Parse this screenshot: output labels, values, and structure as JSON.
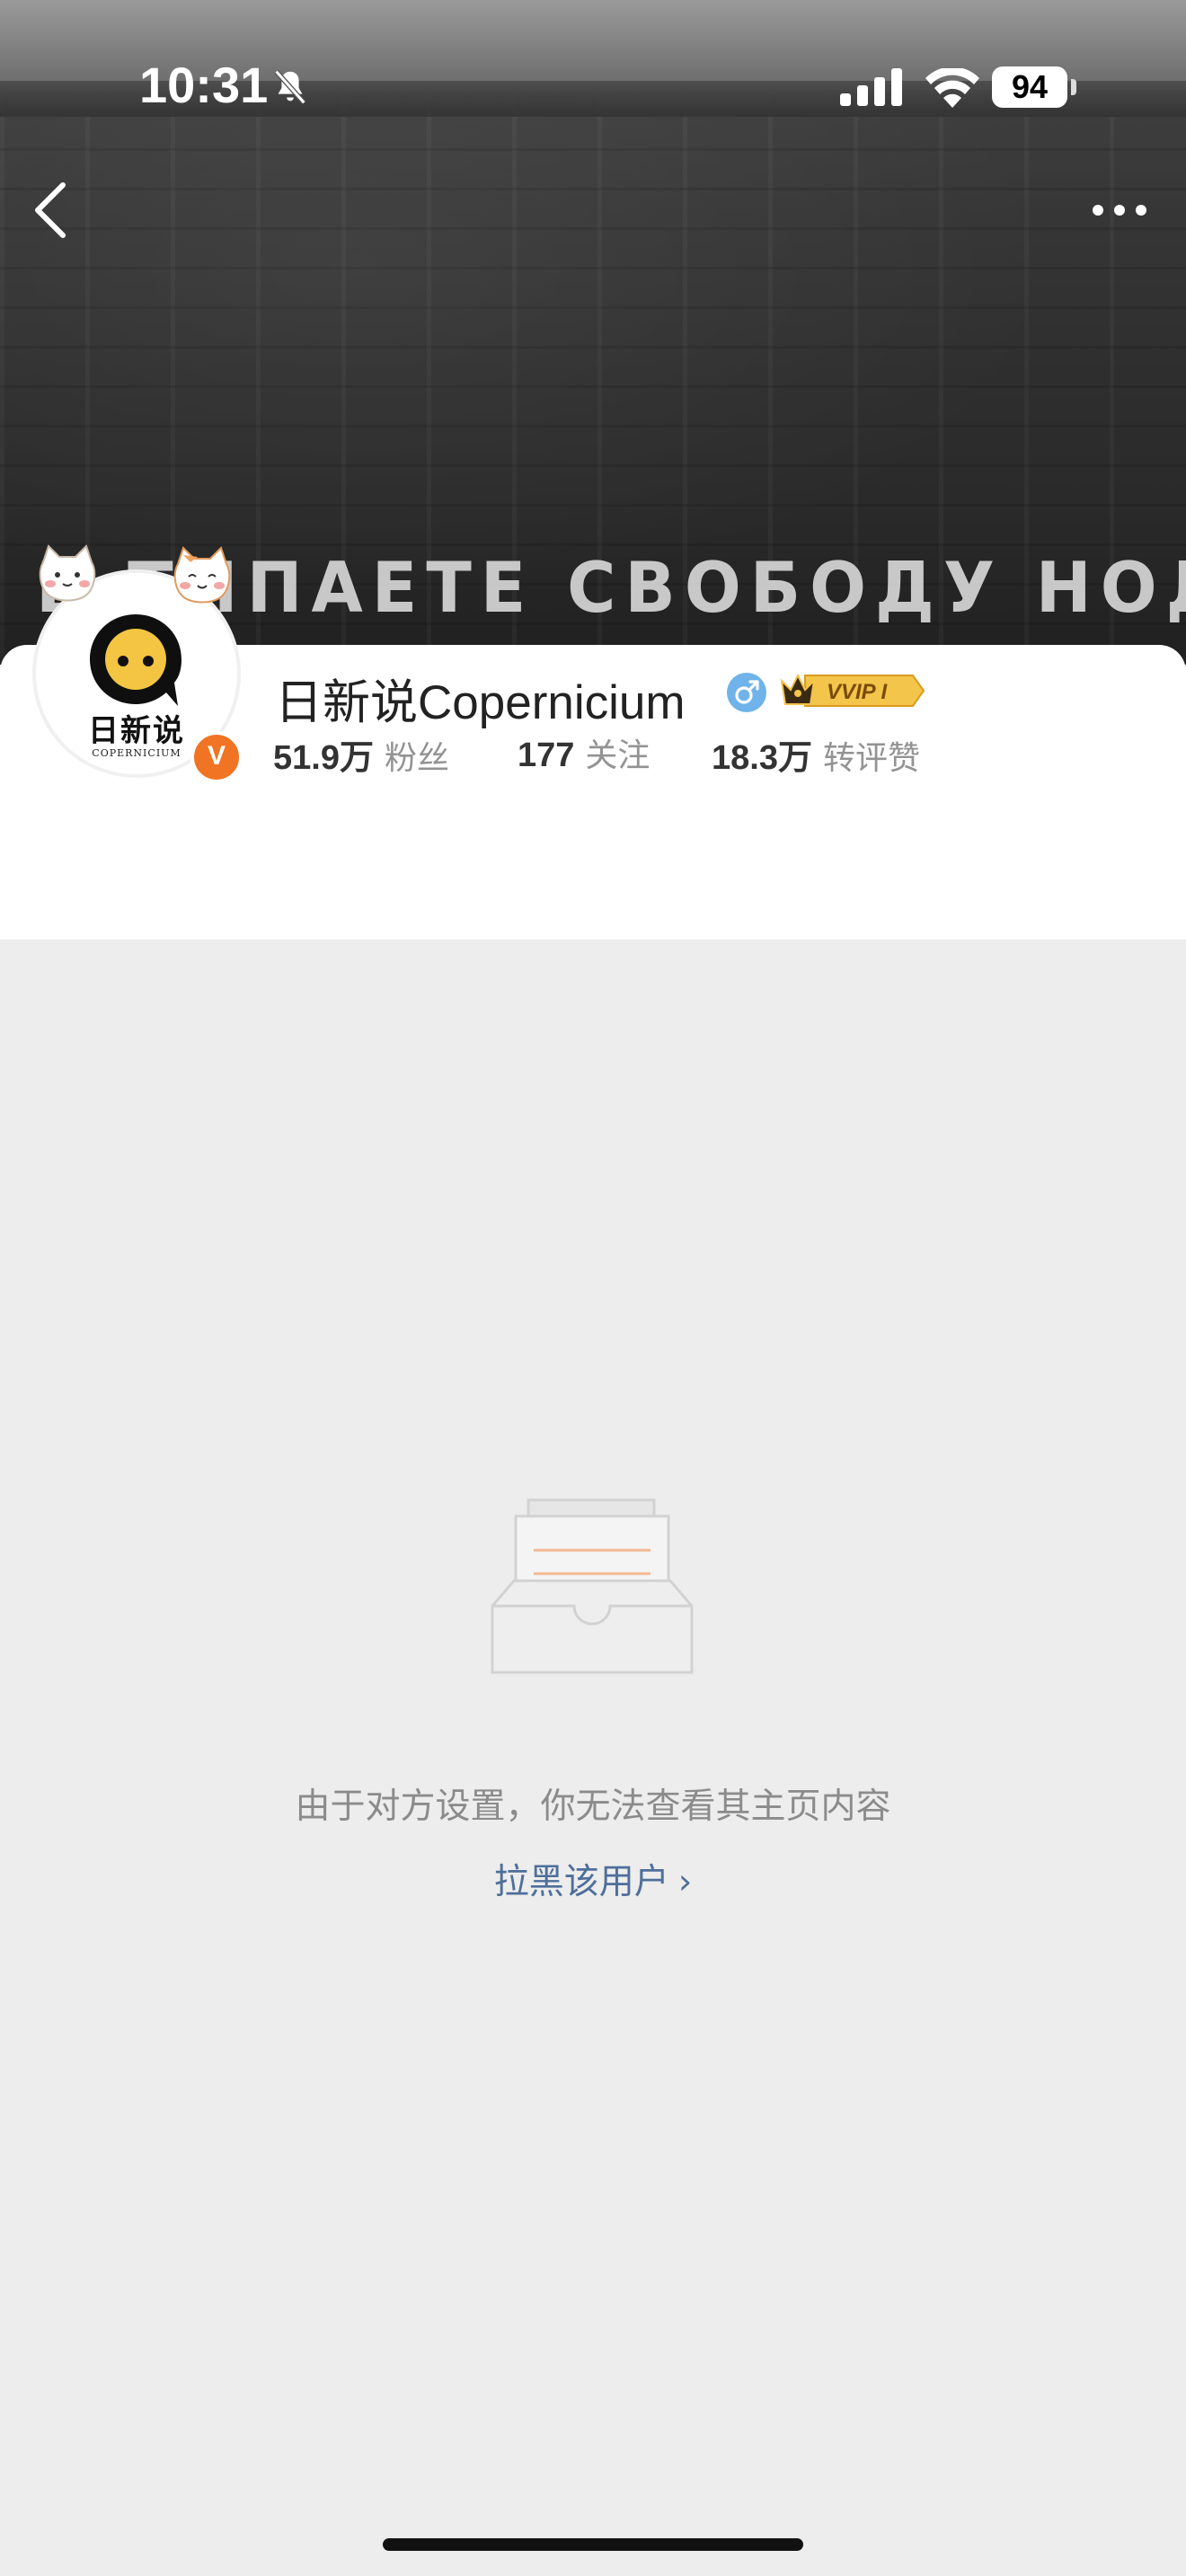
{
  "status_bar": {
    "time": "10:31",
    "battery": "94",
    "icons": [
      "bell-off-icon",
      "cellular-signal-icon",
      "wifi-icon",
      "battery-icon"
    ]
  },
  "nav": {
    "back_icon": "chevron-left-icon",
    "more_icon": "more-dots-icon"
  },
  "banner": {
    "graffiti_text": "В  ТИПАЕТЕ  СВОБОДУ  НОДУ"
  },
  "profile": {
    "avatar_text_cn": "日新说",
    "avatar_text_en": "COPERNICIUM",
    "verified_mark": "V",
    "username": "日新说Copernicium",
    "gender_icon": "male-icon",
    "vip_label": "VVIP I",
    "stats": [
      {
        "value": "51.9万",
        "label": "粉丝"
      },
      {
        "value": "177",
        "label": "关注"
      },
      {
        "value": "18.3万",
        "label": "转评赞"
      }
    ]
  },
  "empty_state": {
    "icon": "empty-inbox-icon",
    "message": "由于对方设置，你无法查看其主页内容",
    "action_label": "拉黑该用户",
    "action_chevron": "›"
  },
  "colors": {
    "link": "#4e6f9a",
    "verified": "#f07423",
    "vip_gold": "#f3c54a",
    "background": "#ededed"
  }
}
